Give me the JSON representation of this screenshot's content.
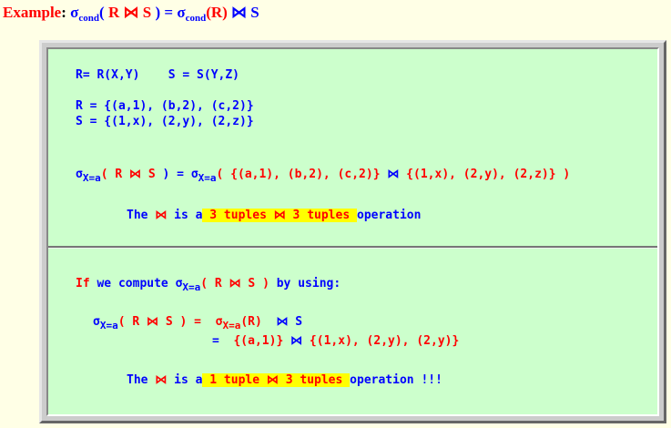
{
  "heading": {
    "prefix": "Example",
    "colon": ": ",
    "sigma": "σ",
    "cond_sub": "cond",
    "lhs_paren_open": "( ",
    "R": "R",
    "join": "⋈",
    "S": "S",
    "lhs_paren_close": " ) = ",
    "rhs_sigma": "σ",
    "rhs_sub": "cond",
    "rhs_R": "(R)"
  },
  "box1": {
    "line1": "R= R(X,Y)    S = S(Y,Z)",
    "line2": "R = {(a,1), (b,2), (c,2)}",
    "line3": "S = {(1,x), (2,y), (2,z)}",
    "sel_sigma": "σ",
    "sel_sub": "X=a",
    "sel_open": "( ",
    "sel_mid": " ) = ",
    "sel_rhs_sigma": "σ",
    "sel_rhs_sub": "X=a",
    "sel_R_set": "( {(a,1), (b,2), (c,2)} ",
    "sel_S_set": " {(1,x), (2,y), (2,z)} )",
    "note_pre": "The ",
    "note_mid": " is a",
    "note_hl": " 3 tuples ⋈ 3 tuples ",
    "note_post": "operation"
  },
  "box2": {
    "if_pre": "If",
    "if_text": " we compute ",
    "if_sigma": "σ",
    "if_sub": "X=a",
    "if_expr": "( R ⋈ S )",
    "if_post": " by using:",
    "eq1_sigma": "σ",
    "eq1_sub": "X=a",
    "eq1_expr": "( R ⋈ S ) =  ",
    "eq1_rhs_sigma": "σ",
    "eq1_rhs_sub": "X=a",
    "eq1_rhs": "(R) ",
    "eq1_join": " ⋈ S",
    "eq2_eq": "=  ",
    "eq2_set": "{(a,1)} ",
    "eq2_rest": " {(1,x), (2,y), (2,y)}",
    "note_pre": "The ",
    "note_mid": " is a",
    "note_hl": " 1 tuple ⋈ 3 tuples ",
    "note_post": "operation !!!"
  }
}
